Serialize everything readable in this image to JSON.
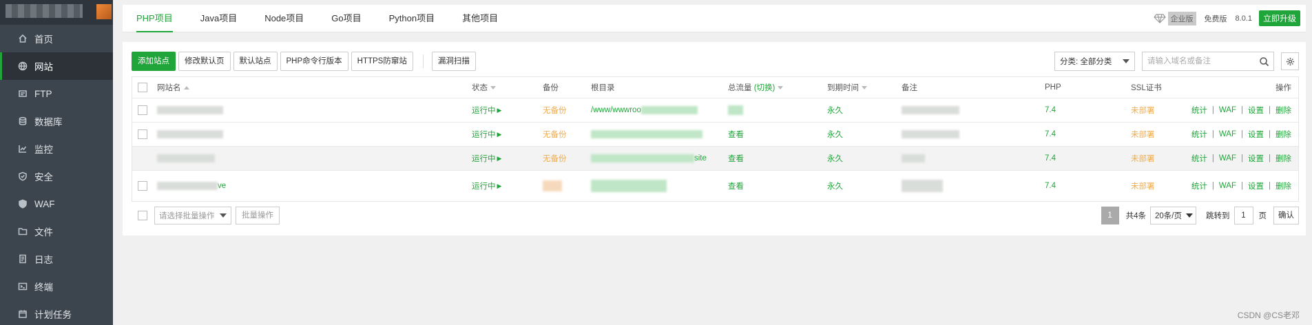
{
  "sidebar": {
    "items": [
      {
        "label": "首页",
        "icon": "home-icon"
      },
      {
        "label": "网站",
        "icon": "globe-icon"
      },
      {
        "label": "FTP",
        "icon": "ftp-icon"
      },
      {
        "label": "数据库",
        "icon": "database-icon"
      },
      {
        "label": "监控",
        "icon": "monitor-icon"
      },
      {
        "label": "安全",
        "icon": "shield-icon"
      },
      {
        "label": "WAF",
        "icon": "waf-shield-icon"
      },
      {
        "label": "文件",
        "icon": "folder-icon"
      },
      {
        "label": "日志",
        "icon": "log-icon"
      },
      {
        "label": "终端",
        "icon": "terminal-icon"
      },
      {
        "label": "计划任务",
        "icon": "calendar-icon"
      }
    ],
    "active_index": 1
  },
  "topbar": {
    "tabs": [
      "PHP项目",
      "Java项目",
      "Node项目",
      "Go项目",
      "Python项目",
      "其他项目"
    ],
    "active_tab": 0,
    "enterprise_badge": "企业版",
    "free_label": "免费版",
    "version": "8.0.1",
    "upgrade": "立即升级"
  },
  "toolbar": {
    "add_site": "添加站点",
    "modify_default_page": "修改默认页",
    "default_site": "默认站点",
    "php_cli_version": "PHP命令行版本",
    "https_guard": "HTTPS防窜站",
    "vuln_scan": "漏洞扫描",
    "category_select": "分类: 全部分类",
    "search_placeholder": "请输入域名或备注"
  },
  "table": {
    "headers": {
      "name": "网站名",
      "status": "状态",
      "backup": "备份",
      "root": "根目录",
      "traffic": "总流量",
      "traffic_switch": "(切换)",
      "expire": "到期时间",
      "remark": "备注",
      "php": "PHP",
      "ssl": "SSL证书",
      "ops": "操作"
    },
    "rows": [
      {
        "name_suffix": "",
        "status": "运行中",
        "backup": "无备份",
        "root": "/www/wwwroo",
        "root_suffix": "",
        "traffic": "",
        "expire": "永久",
        "php": "7.4",
        "ssl": "未部署"
      },
      {
        "name_suffix": "",
        "status": "运行中",
        "backup": "无备份",
        "root": "",
        "root_suffix": "",
        "traffic": "查看",
        "expire": "永久",
        "php": "7.4",
        "ssl": "未部署"
      },
      {
        "name_suffix": "",
        "status": "运行中",
        "backup": "无备份",
        "root": "",
        "root_suffix": "site",
        "traffic": "查看",
        "expire": "永久",
        "php": "7.4",
        "ssl": "未部署"
      },
      {
        "name_suffix": "ve",
        "status": "运行中",
        "backup": "",
        "root": "",
        "root_suffix": "",
        "traffic": "查看",
        "expire": "永久",
        "php": "7.4",
        "ssl": "未部署"
      }
    ],
    "ops": [
      "统计",
      "WAF",
      "设置",
      "删除"
    ],
    "ops_separator": "|"
  },
  "footer": {
    "batch_placeholder": "请选择批量操作",
    "batch_button": "批量操作",
    "current_page": "1",
    "total": "共4条",
    "page_size": "20条/页",
    "goto_label": "跳转到",
    "goto_value": "1",
    "page_unit": "页",
    "confirm": "确认"
  },
  "watermark": "CSDN @CS老邓",
  "colors": {
    "accent": "#20a53a",
    "warning": "#f0ad4e",
    "sidebar": "#3c444d"
  }
}
